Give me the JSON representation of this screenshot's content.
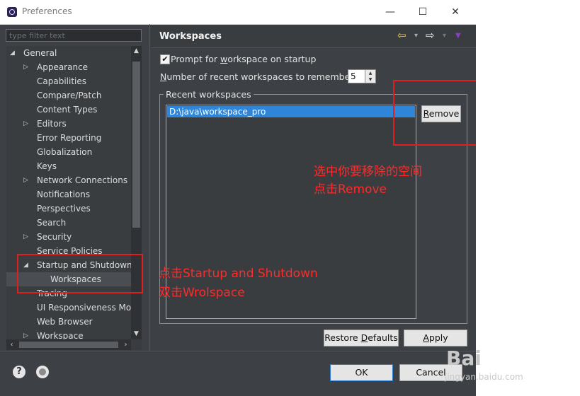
{
  "window": {
    "title": "Preferences"
  },
  "titlebar_buttons": {
    "minimize": "—",
    "maximize": "☐",
    "close": "✕"
  },
  "filter": {
    "placeholder": "type filter text"
  },
  "tree": {
    "items": [
      {
        "label": "General",
        "arrow": "◢"
      },
      {
        "label": "Appearance",
        "arrow": "▷"
      },
      {
        "label": "Capabilities",
        "arrow": ""
      },
      {
        "label": "Compare/Patch",
        "arrow": ""
      },
      {
        "label": "Content Types",
        "arrow": ""
      },
      {
        "label": "Editors",
        "arrow": "▷"
      },
      {
        "label": "Error Reporting",
        "arrow": ""
      },
      {
        "label": "Globalization",
        "arrow": ""
      },
      {
        "label": "Keys",
        "arrow": ""
      },
      {
        "label": "Network Connections",
        "arrow": "▷"
      },
      {
        "label": "Notifications",
        "arrow": ""
      },
      {
        "label": "Perspectives",
        "arrow": ""
      },
      {
        "label": "Search",
        "arrow": ""
      },
      {
        "label": "Security",
        "arrow": "▷"
      },
      {
        "label": "Service Policies",
        "arrow": ""
      },
      {
        "label": "Startup and Shutdown",
        "arrow": "◢"
      },
      {
        "label": "Workspaces",
        "arrow": ""
      },
      {
        "label": "Tracing",
        "arrow": ""
      },
      {
        "label": "UI Responsiveness Mo",
        "arrow": ""
      },
      {
        "label": "Web Browser",
        "arrow": ""
      },
      {
        "label": "Workspace",
        "arrow": "▷"
      }
    ]
  },
  "page": {
    "title": "Workspaces",
    "prompt_label_pre": "Prompt for ",
    "prompt_label_u": "w",
    "prompt_label_post": "orkspace on startup",
    "prompt_checked": "✔",
    "recent_label_u": "N",
    "recent_label_post": "umber of recent workspaces to remember:",
    "recent_value": "5",
    "group_label": "Recent workspaces",
    "workspaces": [
      "D:\\java\\workspace_pro"
    ],
    "remove_u": "R",
    "remove_post": "emove",
    "restore_pre": "Restore ",
    "restore_u": "D",
    "restore_post": "efaults",
    "apply_u": "A",
    "apply_post": "pply"
  },
  "nav": {
    "back": "⇦",
    "forward": "⇨",
    "dropdown": "▾",
    "menu": "▼"
  },
  "buttons": {
    "ok": "OK",
    "cancel": "Cancel"
  },
  "annotations": {
    "remove_note_1": "选中你要移除的空间",
    "remove_note_2": "点击Remove",
    "startup_note_1": "点击Startup and Shutdown",
    "startup_note_2": "双击Wrolspace"
  },
  "watermark": {
    "brand": "Bai",
    "site": "jingyan.baidu.com"
  },
  "colors": {
    "annotation": "#e02020",
    "selection": "#2f86d8",
    "background": "#3d4044"
  }
}
